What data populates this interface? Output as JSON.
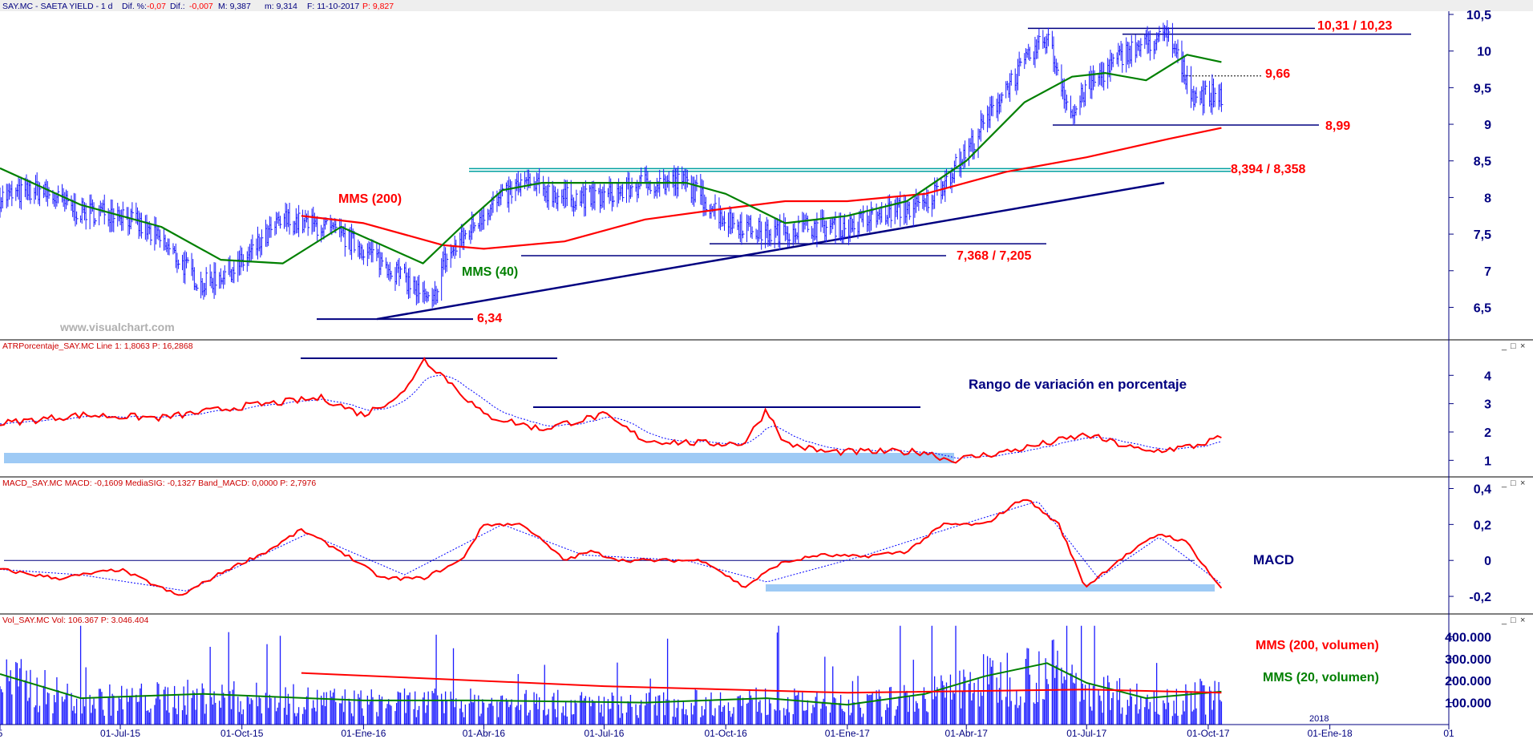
{
  "colors": {
    "price_bar": "#1a1aff",
    "mms200": "#ff0000",
    "mms40": "#008000",
    "signal": "#0000ff",
    "trendline": "#000080",
    "resistance": "#00a0a0",
    "band": "#9ecaf5",
    "annot_red": "#ff0000",
    "annot_navy": "#000080"
  },
  "header": {
    "symbol": "SAY.MC - SAETA YIELD - 1 d",
    "dif_pct_label": "Dif. %:",
    "dif_pct_value": "-0,07",
    "dif_label": "Dif.:",
    "dif_value": "-0,007",
    "m_high": "M: 9,387",
    "m_low": "m: 9,314",
    "date": "F: 11-10-2017",
    "price": "P: 9,827"
  },
  "panels": {
    "atr_header": "ATRPorcentaje_SAY.MC  Line 1: 1,8063  P: 16,2868",
    "macd_header": "MACD_SAY.MC  MACD: -0,1609  MediaSIG: -0,1327  Band_MACD: 0,0000  P: 2,7976",
    "vol_header": "Vol_SAY.MC  Vol: 106.367  P: 3.046.404"
  },
  "window_controls": [
    "_",
    "□",
    "×"
  ],
  "annotations": {
    "mms200": "MMS (200)",
    "mms40": "MMS (40)",
    "watermark": "www.visualchart.com",
    "level_634": "6,34",
    "level_7368": "7,368 / 7,205",
    "level_8394": "8,394 / 8,358",
    "level_899": "8,99",
    "level_966": "9,66",
    "level_1031": "10,31 / 10,23",
    "atr_title": "Rango de variación en porcentaje",
    "macd_title": "MACD",
    "vol_mms200": "MMS (200, volumen)",
    "vol_mms20": "MMS (20, volumen)",
    "year_label": "2018"
  },
  "chart_data": [
    {
      "type": "line",
      "title": "SAY.MC - SAETA YIELD",
      "x_tick_labels": [
        "5",
        "01-Jul-15",
        "01-Oct-15",
        "01-Ene-16",
        "01-Abr-16",
        "01-Jul-16",
        "01-Oct-16",
        "01-Ene-17",
        "01-Abr-17",
        "01-Jul-17",
        "01-Oct-17",
        "01-Ene-18",
        "01"
      ],
      "x_tick_dates": [
        "2015-04-01",
        "2015-07-01",
        "2015-10-01",
        "2016-01-01",
        "2016-04-01",
        "2016-07-01",
        "2016-10-01",
        "2017-01-01",
        "2017-04-01",
        "2017-07-01",
        "2017-10-01",
        "2018-01-01",
        "2018-04-01"
      ],
      "x_range": [
        "2015-04-01",
        "2018-04-01"
      ],
      "y_ticks": [
        "6,5",
        "7",
        "7,5",
        "8",
        "8,5",
        "9",
        "9,5",
        "10",
        "10,5"
      ],
      "ylim": [
        6.1,
        10.5
      ],
      "series": [
        {
          "name": "SAY.MC",
          "style": "ohlc-bars",
          "x": [
            "2015-04-01",
            "2015-05-01",
            "2015-06-01",
            "2015-07-01",
            "2015-08-01",
            "2015-09-01",
            "2015-10-01",
            "2015-11-01",
            "2015-12-01",
            "2016-01-01",
            "2016-02-01",
            "2016-02-22",
            "2016-03-01",
            "2016-04-01",
            "2016-05-01",
            "2016-06-01",
            "2016-07-01",
            "2016-08-01",
            "2016-09-01",
            "2016-10-01",
            "2016-11-01",
            "2016-12-01",
            "2017-01-01",
            "2017-02-01",
            "2017-03-01",
            "2017-04-01",
            "2017-05-01",
            "2017-06-01",
            "2017-06-20",
            "2017-07-01",
            "2017-08-01",
            "2017-09-01",
            "2017-09-20",
            "2017-10-11"
          ],
          "y": [
            8.0,
            8.1,
            7.8,
            7.8,
            7.4,
            6.8,
            7.1,
            7.7,
            7.6,
            7.3,
            6.9,
            6.5,
            7.1,
            7.8,
            8.2,
            8.0,
            8.0,
            8.2,
            8.2,
            7.7,
            7.5,
            7.6,
            7.6,
            7.8,
            7.9,
            8.6,
            9.5,
            10.2,
            9.1,
            9.5,
            10.0,
            10.2,
            9.4,
            9.4
          ]
        },
        {
          "name": "MMS (200)",
          "x": [
            "2015-11-15",
            "2016-01-01",
            "2016-03-01",
            "2016-04-01",
            "2016-06-01",
            "2016-08-01",
            "2016-10-01",
            "2016-11-15",
            "2017-01-01",
            "2017-03-01",
            "2017-05-01",
            "2017-07-01",
            "2017-09-01",
            "2017-10-11"
          ],
          "y": [
            7.75,
            7.65,
            7.35,
            7.3,
            7.4,
            7.7,
            7.85,
            7.95,
            7.95,
            8.05,
            8.35,
            8.55,
            8.8,
            8.95
          ]
        },
        {
          "name": "MMS (40)",
          "x": [
            "2015-04-01",
            "2015-06-01",
            "2015-08-01",
            "2015-09-15",
            "2015-11-01",
            "2015-12-15",
            "2016-02-15",
            "2016-03-15",
            "2016-04-15",
            "2016-05-15",
            "2016-07-01",
            "2016-09-01",
            "2016-10-01",
            "2016-11-15",
            "2017-01-01",
            "2017-02-15",
            "2017-04-01",
            "2017-05-15",
            "2017-06-20",
            "2017-07-15",
            "2017-08-15",
            "2017-09-15",
            "2017-10-11"
          ],
          "y": [
            8.4,
            7.9,
            7.6,
            7.15,
            7.1,
            7.6,
            7.1,
            7.6,
            8.1,
            8.2,
            8.2,
            8.2,
            8.05,
            7.65,
            7.75,
            7.95,
            8.5,
            9.3,
            9.65,
            9.7,
            9.6,
            9.95,
            9.85
          ]
        }
      ],
      "annotations": [
        {
          "text": "6,34",
          "y": 6.34
        },
        {
          "text": "7,368 / 7,205",
          "y": [
            7.368,
            7.205
          ]
        },
        {
          "text": "8,394 / 8,358",
          "y": [
            8.394,
            8.358
          ]
        },
        {
          "text": "8,99",
          "y": 8.99
        },
        {
          "text": "9,66",
          "y": 9.66
        },
        {
          "text": "10,31 / 10,23",
          "y": [
            10.31,
            10.23
          ]
        }
      ]
    },
    {
      "type": "line",
      "title": "ATRPorcentaje_SAY.MC",
      "y_ticks": [
        "1",
        "2",
        "3",
        "4"
      ],
      "ylim": [
        0.5,
        4.8
      ],
      "series": [
        {
          "name": "Line 1",
          "x": [
            "2015-04-01",
            "2015-06-01",
            "2015-08-01",
            "2015-10-01",
            "2015-12-01",
            "2016-01-01",
            "2016-02-01",
            "2016-02-15",
            "2016-03-01",
            "2016-04-01",
            "2016-05-15",
            "2016-06-01",
            "2016-07-01",
            "2016-08-01",
            "2016-09-15",
            "2016-10-15",
            "2016-11-01",
            "2016-11-15",
            "2016-12-15",
            "2017-01-15",
            "2017-03-01",
            "2017-03-20",
            "2017-05-01",
            "2017-07-01",
            "2017-08-15",
            "2017-09-20",
            "2017-10-11"
          ],
          "y": [
            2.3,
            2.6,
            2.5,
            2.9,
            3.2,
            2.6,
            3.4,
            4.6,
            4.0,
            2.6,
            2.1,
            2.3,
            2.6,
            1.7,
            1.6,
            1.6,
            2.8,
            1.6,
            1.3,
            1.3,
            1.3,
            1.0,
            1.3,
            1.9,
            1.3,
            1.5,
            1.8
          ]
        }
      ],
      "annotations": [
        {
          "text": "Rango de variación en porcentaje"
        }
      ]
    },
    {
      "type": "line",
      "title": "MACD_SAY.MC",
      "y_ticks": [
        "-0,2",
        "0",
        "0,2",
        "0,4"
      ],
      "ylim": [
        -0.28,
        0.42
      ],
      "series": [
        {
          "name": "MACD",
          "x": [
            "2015-04-01",
            "2015-05-15",
            "2015-07-01",
            "2015-08-15",
            "2015-09-20",
            "2015-10-20",
            "2015-11-15",
            "2015-12-15",
            "2016-01-15",
            "2016-02-15",
            "2016-03-15",
            "2016-04-01",
            "2016-05-01",
            "2016-06-01",
            "2016-06-20",
            "2016-07-15",
            "2016-08-15",
            "2016-09-15",
            "2016-10-15",
            "2016-11-10",
            "2016-12-10",
            "2017-01-10",
            "2017-02-15",
            "2017-03-15",
            "2017-04-15",
            "2017-05-15",
            "2017-06-10",
            "2017-06-30",
            "2017-07-25",
            "2017-08-25",
            "2017-09-15",
            "2017-10-11"
          ],
          "y": [
            -0.05,
            -0.1,
            -0.05,
            -0.2,
            -0.05,
            0.05,
            0.17,
            0.05,
            -0.1,
            -0.1,
            0.0,
            0.2,
            0.2,
            0.0,
            0.05,
            0.0,
            0.0,
            0.0,
            -0.15,
            -0.02,
            0.03,
            0.02,
            0.05,
            0.2,
            0.2,
            0.35,
            0.2,
            -0.15,
            0.0,
            0.15,
            0.1,
            -0.16
          ]
        },
        {
          "name": "MediaSIG",
          "x": [
            "2015-04-01",
            "2015-06-01",
            "2015-08-20",
            "2015-11-20",
            "2016-02-01",
            "2016-04-15",
            "2016-06-15",
            "2016-09-01",
            "2016-11-01",
            "2017-01-15",
            "2017-03-20",
            "2017-05-25",
            "2017-07-10",
            "2017-08-25",
            "2017-10-11"
          ],
          "y": [
            -0.05,
            -0.08,
            -0.17,
            0.15,
            -0.08,
            0.2,
            0.03,
            0.0,
            -0.12,
            0.03,
            0.18,
            0.33,
            -0.1,
            0.13,
            -0.13
          ]
        }
      ],
      "band": {
        "name": "Band_MACD",
        "value": 0.0
      },
      "annotations": [
        {
          "text": "MACD"
        }
      ]
    },
    {
      "type": "bar",
      "title": "Vol_SAY.MC",
      "y_ticks": [
        "100.000",
        "200.000",
        "300.000",
        "400.000"
      ],
      "ylim": [
        0,
        460000
      ],
      "series": [
        {
          "name": "Vol",
          "last": 106367
        },
        {
          "name": "MMS (200, volumen)",
          "x": [
            "2015-11-15",
            "2016-07-01",
            "2017-01-01",
            "2017-07-01",
            "2017-10-11"
          ],
          "y": [
            235000,
            175000,
            145000,
            160000,
            145000
          ]
        },
        {
          "name": "MMS (20, volumen)",
          "x": [
            "2015-04-01",
            "2015-06-01",
            "2015-09-01",
            "2016-01-01",
            "2016-04-01",
            "2016-08-01",
            "2016-11-01",
            "2017-01-01",
            "2017-03-01",
            "2017-04-15",
            "2017-06-01",
            "2017-07-01",
            "2017-08-15",
            "2017-10-11"
          ],
          "y": [
            230000,
            120000,
            140000,
            110000,
            110000,
            100000,
            120000,
            90000,
            140000,
            220000,
            280000,
            190000,
            120000,
            150000
          ]
        }
      ]
    }
  ]
}
